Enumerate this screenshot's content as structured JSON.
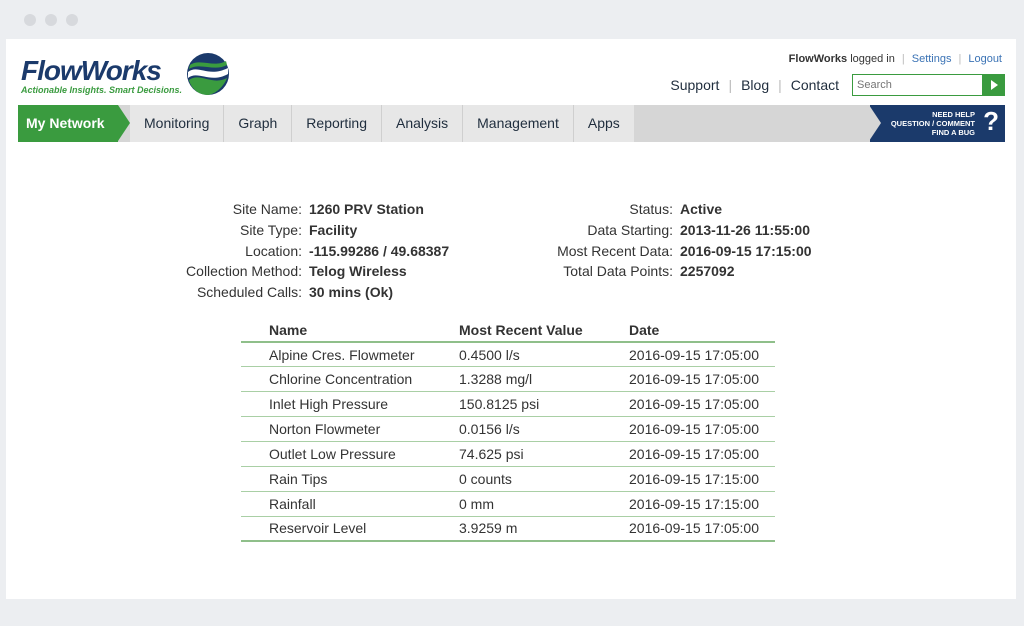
{
  "brand": {
    "name": "FlowWorks",
    "tagline": "Actionable Insights. Smart Decisions.",
    "colors": {
      "navy": "#1b3a6b",
      "green": "#3a9b3f"
    }
  },
  "user_bar": {
    "user": "FlowWorks",
    "logged_in_text": "logged in",
    "settings": "Settings",
    "logout": "Logout"
  },
  "top_nav": [
    "Support",
    "Blog",
    "Contact"
  ],
  "search": {
    "placeholder": "Search"
  },
  "main_nav": {
    "active": "My Network",
    "items": [
      "Monitoring",
      "Graph",
      "Reporting",
      "Analysis",
      "Management",
      "Apps"
    ]
  },
  "help": {
    "line1": "NEED HELP",
    "line2": "QUESTION / COMMENT",
    "line3": "FIND A BUG",
    "icon": "?"
  },
  "site_info": {
    "left": [
      {
        "label": "Site Name:",
        "value": "1260 PRV Station"
      },
      {
        "label": "Site Type:",
        "value": "Facility"
      },
      {
        "label": "Location:",
        "value": "-115.99286 / 49.68387"
      },
      {
        "label": "Collection Method:",
        "value": "Telog Wireless"
      },
      {
        "label": "Scheduled Calls:",
        "value": "30 mins (Ok)"
      }
    ],
    "right": [
      {
        "label": "Status:",
        "value": "Active"
      },
      {
        "label": "Data Starting:",
        "value": "2013-11-26 11:55:00"
      },
      {
        "label": "Most Recent Data:",
        "value": "2016-09-15 17:15:00"
      },
      {
        "label": "Total Data Points:",
        "value": "2257092"
      }
    ]
  },
  "table": {
    "headers": [
      "Name",
      "Most Recent Value",
      "Date"
    ],
    "rows": [
      [
        "Alpine Cres. Flowmeter",
        "0.4500 l/s",
        "2016-09-15 17:05:00"
      ],
      [
        "Chlorine Concentration",
        "1.3288 mg/l",
        "2016-09-15 17:05:00"
      ],
      [
        "Inlet High Pressure",
        "150.8125 psi",
        "2016-09-15 17:05:00"
      ],
      [
        "Norton Flowmeter",
        "0.0156 l/s",
        "2016-09-15 17:05:00"
      ],
      [
        "Outlet Low Pressure",
        "74.625 psi",
        "2016-09-15 17:05:00"
      ],
      [
        "Rain Tips",
        "0 counts",
        "2016-09-15 17:15:00"
      ],
      [
        "Rainfall",
        "0 mm",
        "2016-09-15 17:15:00"
      ],
      [
        "Reservoir Level",
        "3.9259 m",
        "2016-09-15 17:05:00"
      ]
    ]
  }
}
